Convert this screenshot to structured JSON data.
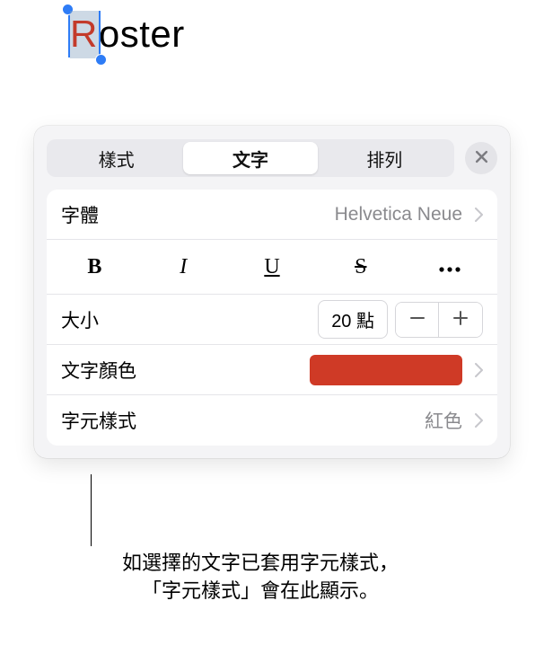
{
  "canvas": {
    "selected_char": "R",
    "rest_text": "oster"
  },
  "panel": {
    "tabs": {
      "style": "樣式",
      "text": "文字",
      "arrange": "排列"
    },
    "font": {
      "label": "字體",
      "value": "Helvetica Neue"
    },
    "format": {
      "bold": "B",
      "italic": "I",
      "underline": "U",
      "strikethrough": "S"
    },
    "size": {
      "label": "大小",
      "value": "20 點"
    },
    "text_color": {
      "label": "文字顏色",
      "color": "#cf3a26"
    },
    "char_style": {
      "label": "字元樣式",
      "value": "紅色"
    }
  },
  "callout": {
    "line1": "如選擇的文字已套用字元樣式，",
    "line2": "「字元樣式」會在此顯示。"
  }
}
